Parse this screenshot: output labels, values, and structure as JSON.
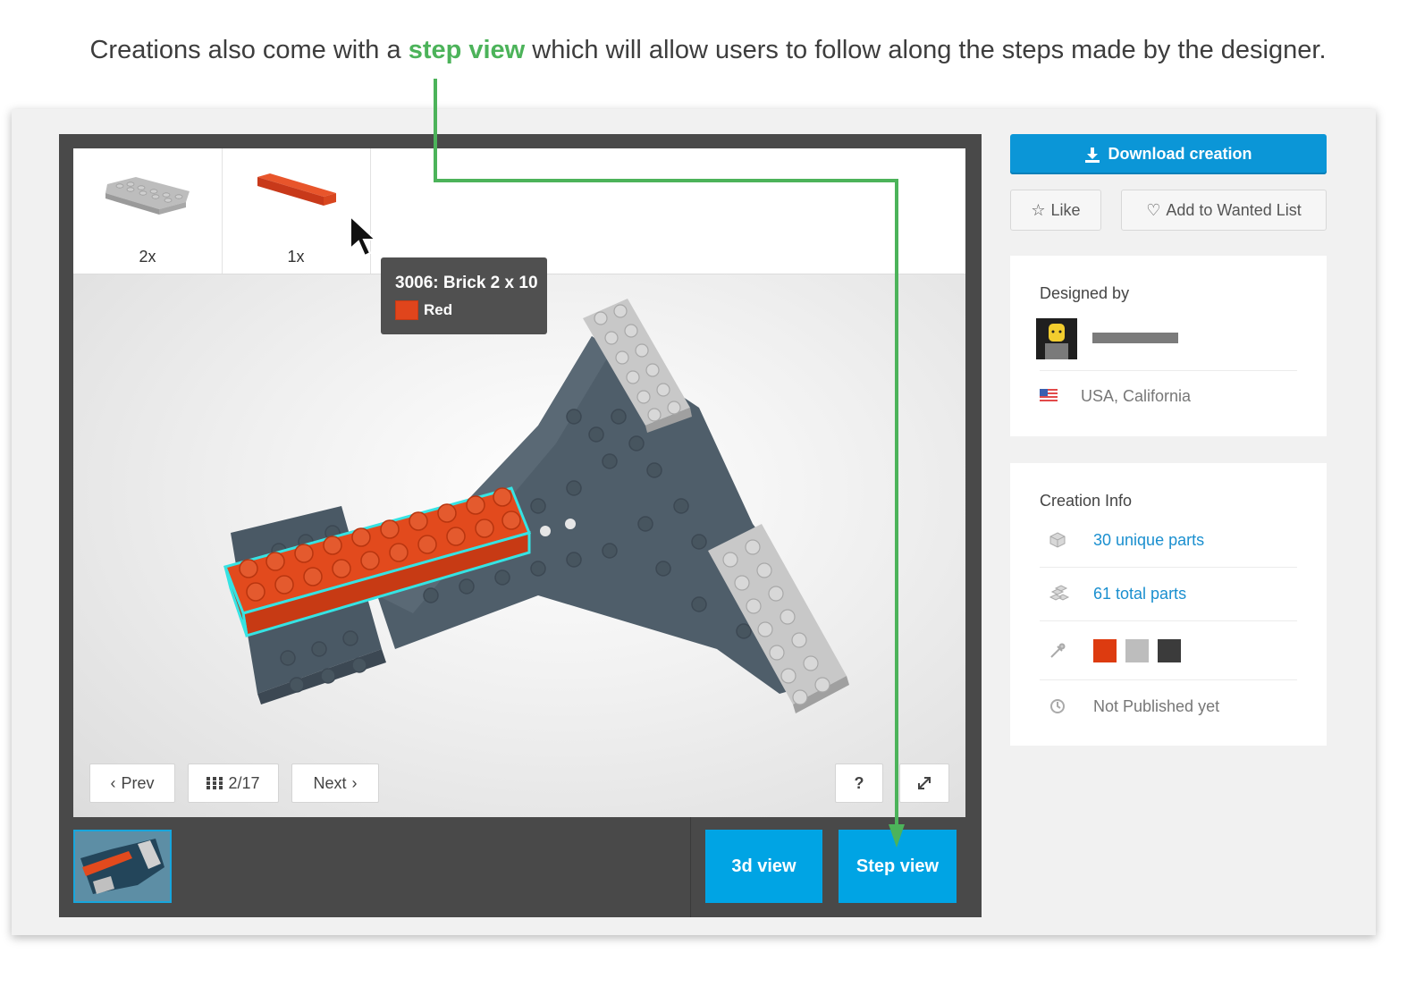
{
  "caption": {
    "before": "Creations also come with a ",
    "highlight": "step view",
    "after": " which will allow users to follow along the steps made by the designer."
  },
  "viewer": {
    "parts": [
      {
        "qty": "2x",
        "color": "#b9b9b9",
        "icon": "plate-2x6-light-gray"
      },
      {
        "qty": "1x",
        "color": "#e0451c",
        "icon": "brick-2x10-red"
      }
    ],
    "tooltip": {
      "title": "3006: Brick 2 x 10",
      "color_name": "Red",
      "color": "#e0451c"
    },
    "controls": {
      "prev": "Prev",
      "step_counter": "2/17",
      "next": "Next",
      "help": "?",
      "fullscreen_icon": "expand-icon"
    },
    "modes": {
      "three_d": "3d view",
      "step": "Step view"
    }
  },
  "sidebar": {
    "download": "Download creation",
    "like": "Like",
    "wanted": "Add to Wanted List",
    "designer": {
      "heading": "Designed by",
      "location": "USA, California"
    },
    "info": {
      "heading": "Creation Info",
      "unique_parts": "30 unique parts",
      "total_parts": "61 total parts",
      "colors": [
        "#dd3b10",
        "#bdbdbd",
        "#3b3b3b"
      ],
      "status": "Not Published yet"
    }
  },
  "colors": {
    "accent": "#00a4e4",
    "highlight_green": "#4cb35a",
    "link": "#1a8fcf"
  }
}
